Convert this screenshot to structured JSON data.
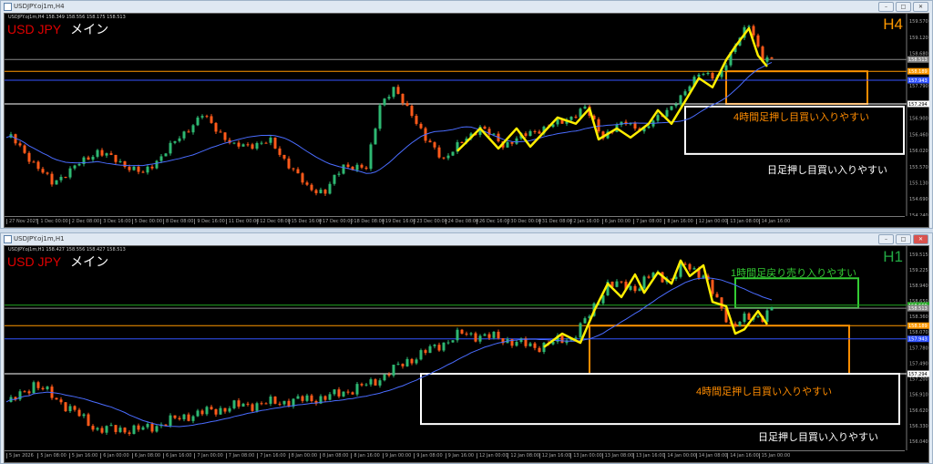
{
  "panels": [
    {
      "window_title": "USDJPY.oj1m,H4",
      "header": "USDJPY.oj1m,H4  158.349 158.556 158.175 158.513",
      "symbol": "USD JPY",
      "label": "メイン",
      "timeframe": "H4",
      "tf_color": "#ff9900",
      "notes": [
        {
          "text": "4時間足押し目買い入りやすい",
          "color": "#ff8c00"
        },
        {
          "text": "日足押し目買い入りやすい",
          "color": "#ffffff"
        }
      ],
      "time_labels": [
        "27 Nov 2025",
        "1 Dec 00:00",
        "2 Dec 08:00",
        "3 Dec 16:00",
        "5 Dec 00:00",
        "8 Dec 08:00",
        "9 Dec 16:00",
        "11 Dec 00:00",
        "12 Dec 08:00",
        "15 Dec 16:00",
        "17 Dec 00:00",
        "18 Dec 08:00",
        "19 Dec 16:00",
        "23 Dec 00:00",
        "24 Dec 08:00",
        "26 Dec 16:00",
        "30 Dec 00:00",
        "31 Dec 08:00",
        "2 Jan 16:00",
        "6 Jan 00:00",
        "7 Jan 08:00",
        "8 Jan 16:00",
        "12 Jan 00:00",
        "13 Jan 08:00",
        "14 Jan 16:00"
      ],
      "price_labels": [
        "159.570",
        "159.120",
        "158.680",
        "157.790",
        "156.900",
        "156.460",
        "156.020",
        "155.570",
        "155.130",
        "154.690",
        "154.240"
      ]
    },
    {
      "window_title": "USDJPY.oj1m,H1",
      "header": "USDJPY.oj1m,H1  158.427 158.556 158.427 158.513",
      "symbol": "USD JPY",
      "label": "メイン",
      "timeframe": "H1",
      "tf_color": "#22aa44",
      "notes": [
        {
          "text": "1時間足戻り売り入りやすい",
          "color": "#33cc33"
        },
        {
          "text": "4時間足押し目買い入りやすい",
          "color": "#ff8c00"
        },
        {
          "text": "日足押し目買い入りやすい",
          "color": "#ffffff"
        }
      ],
      "time_labels": [
        "5 Jan 2026",
        "5 Jan 08:00",
        "5 Jan 16:00",
        "6 Jan 00:00",
        "6 Jan 08:00",
        "6 Jan 16:00",
        "7 Jan 00:00",
        "7 Jan 08:00",
        "7 Jan 16:00",
        "8 Jan 00:00",
        "8 Jan 08:00",
        "8 Jan 16:00",
        "9 Jan 00:00",
        "9 Jan 08:00",
        "9 Jan 16:00",
        "12 Jan 00:00",
        "12 Jan 08:00",
        "12 Jan 16:00",
        "13 Jan 00:00",
        "13 Jan 08:00",
        "13 Jan 16:00",
        "14 Jan 00:00",
        "14 Jan 08:00",
        "14 Jan 16:00",
        "15 Jan 00:00"
      ],
      "price_labels": [
        "159.515",
        "159.225",
        "158.940",
        "158.650",
        "158.360",
        "158.070",
        "157.780",
        "157.490",
        "157.200",
        "156.910",
        "156.620",
        "156.330",
        "156.040"
      ]
    }
  ],
  "chart_data": [
    {
      "type": "candlestick",
      "title": "USDJPY H4",
      "ylim": [
        154.24,
        159.57
      ],
      "close_keypoints": [
        [
          1,
          156.37
        ],
        [
          10,
          155.12
        ],
        [
          20,
          156.0
        ],
        [
          30,
          155.37
        ],
        [
          43,
          156.99
        ],
        [
          50,
          156.12
        ],
        [
          58,
          156.25
        ],
        [
          66,
          155.0
        ],
        [
          70,
          154.87
        ],
        [
          74,
          155.62
        ],
        [
          79,
          155.5
        ],
        [
          82,
          157.3
        ],
        [
          85,
          157.67
        ],
        [
          89,
          157.05
        ],
        [
          92,
          156.3
        ],
        [
          96,
          155.8
        ],
        [
          104,
          156.67
        ],
        [
          109,
          156.17
        ],
        [
          116,
          156.55
        ],
        [
          122,
          156.8
        ],
        [
          127,
          157.17
        ],
        [
          131,
          156.42
        ],
        [
          136,
          156.8
        ],
        [
          140,
          156.55
        ],
        [
          144,
          157.05
        ],
        [
          148,
          157.42
        ],
        [
          152,
          158.2
        ],
        [
          156,
          157.95
        ],
        [
          160,
          158.95
        ],
        [
          163,
          159.45
        ],
        [
          166,
          158.57
        ],
        [
          168,
          158.51
        ]
      ],
      "zigzag": [
        [
          99,
          156.0
        ],
        [
          104,
          156.62
        ],
        [
          108,
          156.07
        ],
        [
          112,
          156.62
        ],
        [
          115,
          156.12
        ],
        [
          121,
          156.92
        ],
        [
          125,
          156.75
        ],
        [
          128,
          157.17
        ],
        [
          130,
          156.32
        ],
        [
          134,
          156.62
        ],
        [
          137,
          156.37
        ],
        [
          141,
          156.75
        ],
        [
          143,
          157.12
        ],
        [
          146,
          156.75
        ],
        [
          149,
          157.37
        ],
        [
          152,
          158.0
        ],
        [
          155,
          157.75
        ],
        [
          158,
          158.5
        ],
        [
          160,
          158.87
        ],
        [
          163,
          159.37
        ],
        [
          165,
          158.62
        ],
        [
          167,
          158.32
        ]
      ],
      "hlines": [
        {
          "price": 158.513,
          "color": "#888888",
          "tag": "158.513"
        },
        {
          "price": 158.189,
          "color": "#ff9900",
          "tag": "158.189"
        },
        {
          "price": 157.943,
          "color": "#3355ff",
          "tag": "157.943"
        },
        {
          "price": 157.294,
          "color": "#ffffff",
          "tag": "157.294"
        }
      ],
      "boxes": [
        {
          "from_bar": 158,
          "to_bar": 189,
          "high": 158.189,
          "low": 157.294,
          "color": "#ff8c00"
        },
        {
          "from_bar": 149,
          "to_bar": 197,
          "high": 157.22,
          "low": 155.92,
          "color": "#ffffff"
        }
      ]
    },
    {
      "type": "candlestick",
      "title": "USDJPY H1",
      "ylim": [
        156.04,
        159.515
      ],
      "close_keypoints": [
        [
          1,
          156.77
        ],
        [
          6,
          157.11
        ],
        [
          12,
          156.77
        ],
        [
          20,
          156.26
        ],
        [
          30,
          156.26
        ],
        [
          40,
          156.52
        ],
        [
          50,
          156.69
        ],
        [
          60,
          156.77
        ],
        [
          70,
          156.85
        ],
        [
          80,
          157.11
        ],
        [
          88,
          157.53
        ],
        [
          96,
          157.87
        ],
        [
          100,
          158.04
        ],
        [
          108,
          157.96
        ],
        [
          116,
          157.79
        ],
        [
          124,
          157.96
        ],
        [
          128,
          158.38
        ],
        [
          132,
          158.97
        ],
        [
          138,
          158.89
        ],
        [
          142,
          159.14
        ],
        [
          146,
          159.06
        ],
        [
          149,
          159.31
        ],
        [
          153,
          159.14
        ],
        [
          156,
          158.63
        ],
        [
          159,
          158.21
        ],
        [
          162,
          158.3
        ],
        [
          166,
          158.38
        ],
        [
          168,
          158.51
        ]
      ],
      "zigzag": [
        [
          118,
          157.79
        ],
        [
          122,
          158.04
        ],
        [
          126,
          157.87
        ],
        [
          129,
          158.46
        ],
        [
          132,
          158.97
        ],
        [
          135,
          158.72
        ],
        [
          138,
          159.14
        ],
        [
          140,
          158.8
        ],
        [
          143,
          159.18
        ],
        [
          146,
          158.97
        ],
        [
          148,
          159.4
        ],
        [
          150,
          159.11
        ],
        [
          153,
          159.31
        ],
        [
          155,
          158.63
        ],
        [
          158,
          158.55
        ],
        [
          160,
          158.04
        ],
        [
          162,
          158.12
        ],
        [
          165,
          158.46
        ],
        [
          167,
          158.21
        ]
      ],
      "hlines": [
        {
          "price": 158.569,
          "color": "#22aa22",
          "tag": "158.569"
        },
        {
          "price": 158.513,
          "color": "#888888",
          "tag": "158.513"
        },
        {
          "price": 158.189,
          "color": "#ff9900",
          "tag": "158.189"
        },
        {
          "price": 157.943,
          "color": "#3355ff",
          "tag": "157.943"
        },
        {
          "price": 157.294,
          "color": "#ffffff",
          "tag": "157.294"
        }
      ],
      "boxes": [
        {
          "from_bar": 160,
          "to_bar": 187,
          "high": 159.07,
          "low": 158.52,
          "color": "#33cc33"
        },
        {
          "from_bar": 128,
          "to_bar": 185,
          "high": 158.189,
          "low": 157.294,
          "color": "#ff8c00"
        },
        {
          "from_bar": 91,
          "to_bar": 196,
          "high": 157.294,
          "low": 156.36,
          "color": "#ffffff"
        }
      ]
    }
  ]
}
